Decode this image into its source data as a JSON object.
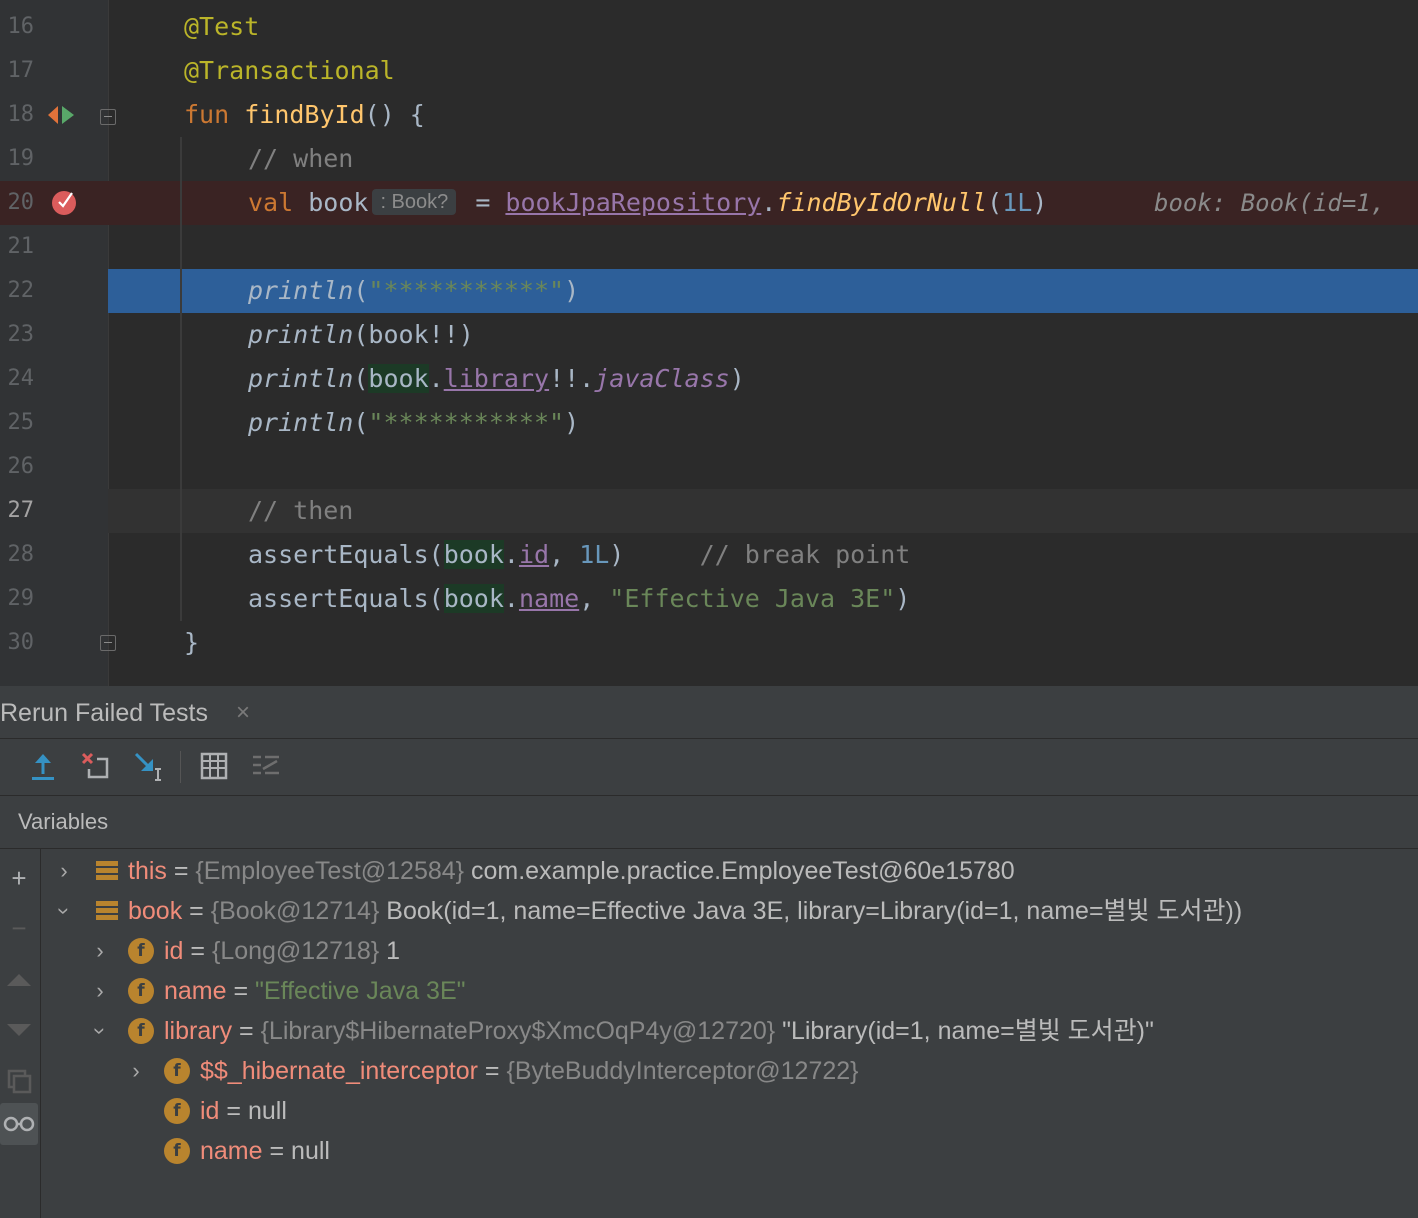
{
  "editor": {
    "lines": [
      {
        "num": "16"
      },
      {
        "num": "17"
      },
      {
        "num": "18"
      },
      {
        "num": "19"
      },
      {
        "num": "20"
      },
      {
        "num": "21"
      },
      {
        "num": "22"
      },
      {
        "num": "23"
      },
      {
        "num": "24"
      },
      {
        "num": "25"
      },
      {
        "num": "26"
      },
      {
        "num": "27"
      },
      {
        "num": "28"
      },
      {
        "num": "29"
      },
      {
        "num": "30"
      }
    ],
    "code": {
      "l16": "@Test",
      "l17": "@Transactional",
      "l18_kw": "fun",
      "l18_fn": "findById",
      "l18_rest": "() {",
      "l19": "// when",
      "l20_kw": "val",
      "l20_var": "book",
      "l20_hint": ": Book?",
      "l20_eq": " = ",
      "l20_repo": "bookJpaRepository",
      "l20_dot": ".",
      "l20_call": "findByIdOrNull",
      "l20_open": "(",
      "l20_arg": "1L",
      "l20_close": ")",
      "l20_inline": "book: Book(id=1,",
      "println": "println",
      "l22_str": "\"***********\"",
      "l23_args": "(book!!)",
      "l24_book": "book",
      "l24_library": "library",
      "l24_bang": "!!.",
      "l24_javaclass": "javaClass",
      "l25_str": "\"***********\"",
      "l27": "// then",
      "assert": "assertEquals",
      "l28_book": "book",
      "l28_id": "id",
      "l28_num": "1L",
      "l28_cmt": "// break point",
      "l29_book": "book",
      "l29_name": "name",
      "l29_str": "\"Effective Java 3E\"",
      "l30": "}"
    }
  },
  "debug_panel": {
    "tab_title": "Rerun Failed Tests",
    "close_glyph": "×",
    "section_title": "Variables",
    "variables": [
      {
        "name": "this",
        "type": "{EmployeeTest@12584}",
        "value": "com.example.practice.EmployeeTest@60e15780"
      },
      {
        "name": "book",
        "type": "{Book@12714}",
        "value": "Book(id=1, name=Effective Java 3E, library=Library(id=1, name=별빛 도서관))"
      },
      {
        "name": "id",
        "type": "{Long@12718}",
        "value": "1"
      },
      {
        "name": "name",
        "value": "\"Effective Java 3E\""
      },
      {
        "name": "library",
        "type": "{Library$HibernateProxy$XmcOqP4y@12720}",
        "value": "\"Library(id=1, name=별빛 도서관)\""
      },
      {
        "name": "$$_hibernate_interceptor",
        "type": "{ByteBuddyInterceptor@12722}"
      },
      {
        "name": "id",
        "value": "null"
      },
      {
        "name": "name",
        "value": "null"
      }
    ],
    "eq": " = ",
    "field_icon_letter": "f"
  },
  "colors": {
    "background": "#2b2b2b",
    "current_line": "#2d5f99",
    "breakpoint_line": "#3a2323",
    "keyword": "#cc7832",
    "annotation": "#bbb529",
    "function": "#ffc66d",
    "string": "#6a8759",
    "number": "#6897bb",
    "property": "#9876aa",
    "var_name": "#f08c7a"
  }
}
